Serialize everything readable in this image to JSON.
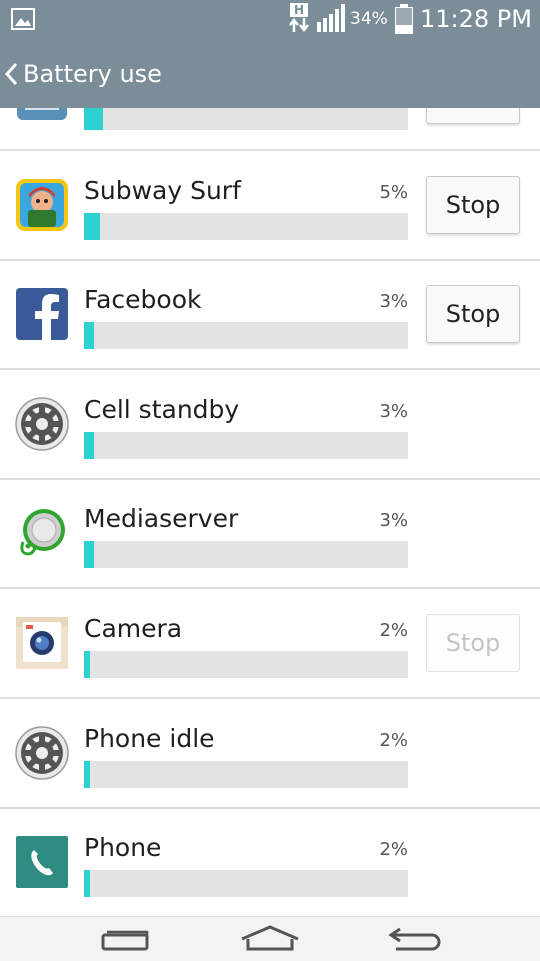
{
  "status_bar": {
    "network_type": "H",
    "battery_percent": "34%",
    "battery_level": 0.34,
    "time": "11:28 PM",
    "icons": [
      "gallery-icon",
      "network-arrows-icon",
      "signal-icon",
      "battery-icon"
    ]
  },
  "header": {
    "back_icon": "chevron-left-icon",
    "title": "Battery use"
  },
  "colors": {
    "bar_background": "#7b8d99",
    "usage_fill": "#2ed1d1",
    "usage_track": "#e3e3e3"
  },
  "apps": [
    {
      "name": "",
      "percent": "",
      "usage": 0.06,
      "stop": "",
      "stop_enabled": true,
      "icon": "app-icon"
    },
    {
      "name": "Subway Surf",
      "percent": "5%",
      "usage": 0.05,
      "stop": "Stop",
      "stop_enabled": true,
      "icon": "subway-surf-icon"
    },
    {
      "name": "Facebook",
      "percent": "3%",
      "usage": 0.03,
      "stop": "Stop",
      "stop_enabled": true,
      "icon": "facebook-icon"
    },
    {
      "name": "Cell standby",
      "percent": "3%",
      "usage": 0.03,
      "stop": null,
      "icon": "settings-gear-icon"
    },
    {
      "name": "Mediaserver",
      "percent": "3%",
      "usage": 0.03,
      "stop": null,
      "icon": "mediaserver-icon"
    },
    {
      "name": "Camera",
      "percent": "2%",
      "usage": 0.02,
      "stop": "Stop",
      "stop_enabled": false,
      "icon": "camera-icon"
    },
    {
      "name": "Phone idle",
      "percent": "2%",
      "usage": 0.02,
      "stop": null,
      "icon": "settings-gear-icon"
    },
    {
      "name": "Phone",
      "percent": "2%",
      "usage": 0.02,
      "stop": null,
      "icon": "phone-icon"
    }
  ],
  "nav": {
    "recent_icon": "recent-apps-icon",
    "home_icon": "home-icon",
    "back_icon": "back-icon"
  }
}
